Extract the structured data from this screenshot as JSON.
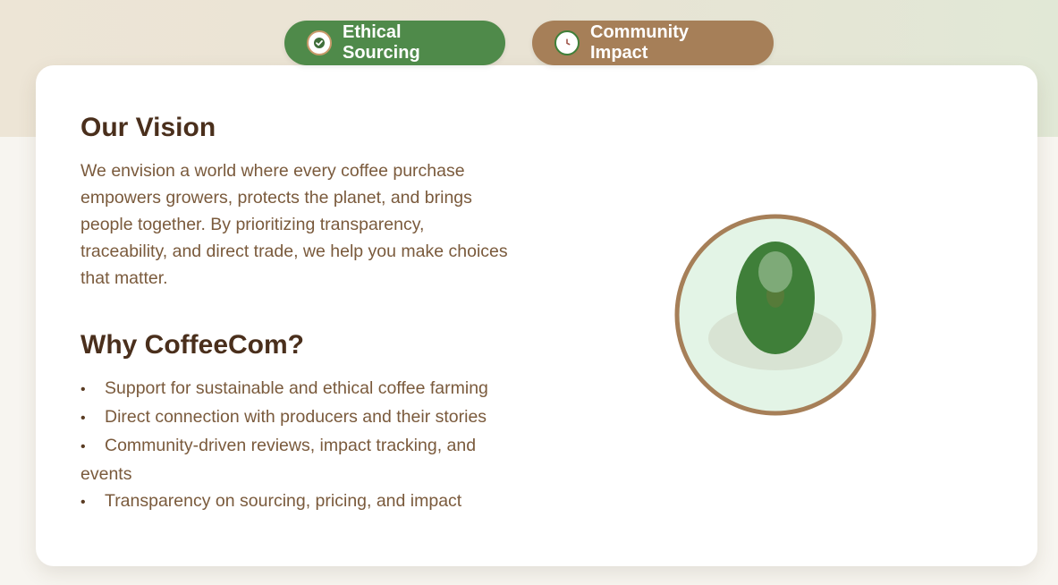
{
  "tabs": [
    {
      "label": "Ethical Sourcing",
      "icon": "check-icon",
      "color": "#4f8a4a"
    },
    {
      "label": "Community Impact",
      "icon": "clock-icon",
      "color": "#a67f58"
    }
  ],
  "vision": {
    "title": "Our Vision",
    "text": "We envision a world where every coffee purchase empowers growers, protects the planet, and brings people together. By prioritizing transparency, traceability, and direct trade, we help you make choices that matter."
  },
  "why": {
    "title": "Why CoffeeCom?",
    "items": [
      "Support for sustainable and ethical coffee farming",
      "Direct connection with producers and their stories",
      "Community-driven reviews, impact tracking, and events",
      "Transparency on sourcing, pricing, and impact"
    ]
  },
  "colors": {
    "heading": "#4a2f1c",
    "body_text": "#7a5a3c",
    "accent_green": "#3f7f39",
    "accent_brown": "#a67f58"
  }
}
